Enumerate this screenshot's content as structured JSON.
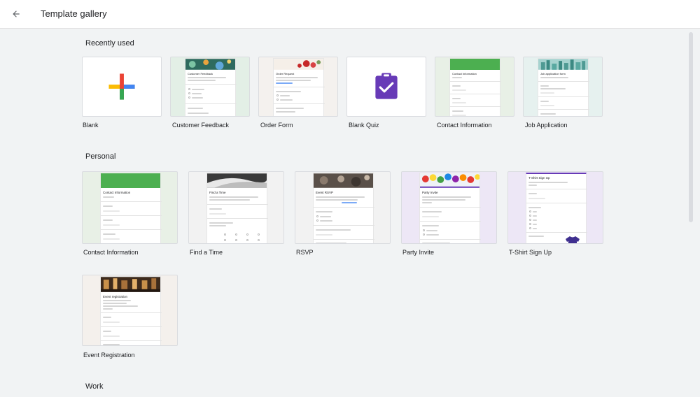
{
  "header": {
    "back_icon": "arrow-left-icon",
    "title": "Template gallery"
  },
  "sections": {
    "recent": {
      "title": "Recently used"
    },
    "personal": {
      "title": "Personal"
    },
    "work": {
      "title": "Work"
    }
  },
  "templates": {
    "recent": [
      {
        "label": "Blank"
      },
      {
        "label": "Customer Feedback",
        "form_title": "Customer Feedback"
      },
      {
        "label": "Order Form",
        "form_title": "Order Request"
      },
      {
        "label": "Blank Quiz"
      },
      {
        "label": "Contact Information",
        "form_title": "Contact Information"
      },
      {
        "label": "Job Application",
        "form_title": "Job application form"
      }
    ],
    "personal": [
      {
        "label": "Contact Information",
        "form_title": "Contact Information"
      },
      {
        "label": "Find a Time",
        "form_title": "Find a Time"
      },
      {
        "label": "RSVP",
        "form_title": "Event RSVP"
      },
      {
        "label": "Party Invite",
        "form_title": "Party Invite"
      },
      {
        "label": "T-Shirt Sign Up",
        "form_title": "T-Shirt Sign Up"
      },
      {
        "label": "Event Registration",
        "form_title": "Event registration"
      }
    ]
  },
  "colors": {
    "plus_blue": "#4285f4",
    "plus_red": "#ea4335",
    "plus_yellow": "#fbbc04",
    "plus_green": "#34a853",
    "quiz_purple": "#673ab7",
    "contact_green": "#4caf50",
    "card_green_bg": "#e8f0e6",
    "tshirt_bg": "#ede7f6"
  }
}
